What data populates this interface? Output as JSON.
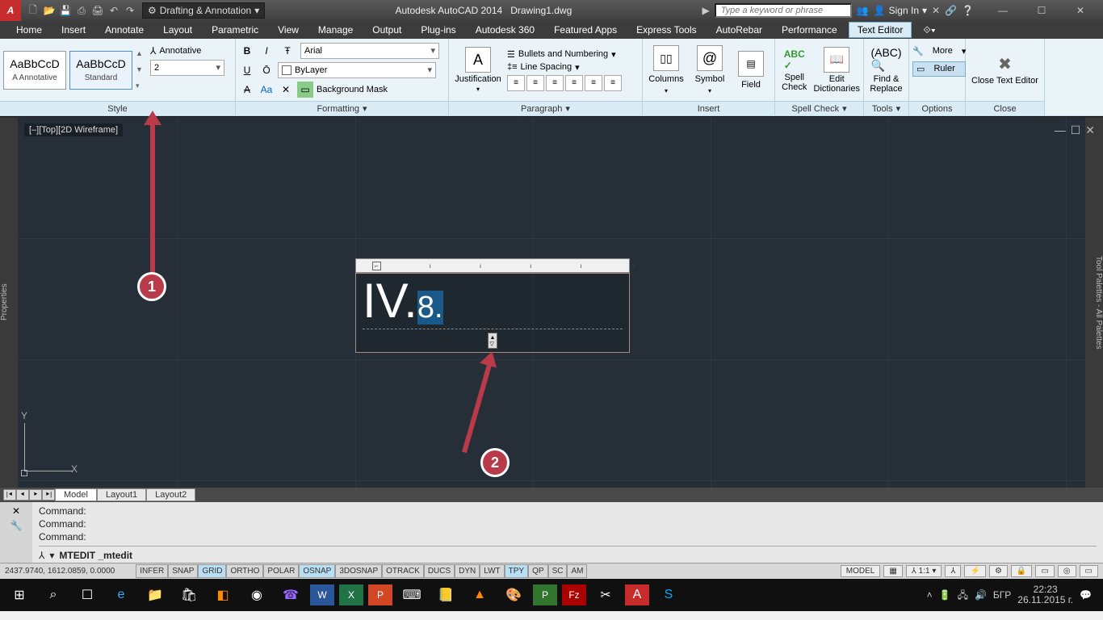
{
  "title": {
    "app": "Autodesk AutoCAD 2014",
    "file": "Drawing1.dwg"
  },
  "workspace": "Drafting & Annotation",
  "search_placeholder": "Type a keyword or phrase",
  "signin": "Sign In",
  "tabs": [
    "Home",
    "Insert",
    "Annotate",
    "Layout",
    "Parametric",
    "View",
    "Manage",
    "Output",
    "Plug-ins",
    "Autodesk 360",
    "Featured Apps",
    "Express Tools",
    "AutoRebar",
    "Performance",
    "Text Editor"
  ],
  "active_tab": "Text Editor",
  "style": {
    "swatches": [
      {
        "sample": "AaBbCcD",
        "label": "A Annotative"
      },
      {
        "sample": "AaBbCcD",
        "label": "Standard"
      }
    ],
    "annotative": "Annotative",
    "size": "2",
    "panel": "Style"
  },
  "formatting": {
    "font": "Arial",
    "layer": "ByLayer",
    "bgmask": "Background Mask",
    "panel": "Formatting"
  },
  "paragraph": {
    "justification": "Justification",
    "bullets": "Bullets and Numbering",
    "linespacing": "Line Spacing",
    "panel": "Paragraph"
  },
  "insert": {
    "columns": "Columns",
    "symbol": "Symbol",
    "field": "Field",
    "panel": "Insert"
  },
  "spellcheck": {
    "spell": "Spell\nCheck",
    "dict": "Edit\nDictionaries",
    "panel": "Spell Check"
  },
  "tools": {
    "find": "Find &\nReplace",
    "panel": "Tools"
  },
  "options": {
    "more": "More",
    "ruler": "Ruler",
    "panel": "Options"
  },
  "close": {
    "btn": "Close Text Editor",
    "panel": "Close"
  },
  "canvas": {
    "view_label": "[–][Top][2D Wireframe]",
    "text_large": "IV.",
    "text_small": "8.",
    "properties": "Properties",
    "toolpalettes": "Tool Palettes - All Palettes"
  },
  "markers": {
    "m1": "1",
    "m2": "2"
  },
  "layout_tabs": [
    "Model",
    "Layout1",
    "Layout2"
  ],
  "command": {
    "history": [
      "Command:",
      "Command:",
      "Command:"
    ],
    "current": "MTEDIT _mtedit"
  },
  "status": {
    "coords": "2437.9740, 1612.0859, 0.0000",
    "toggles": [
      "INFER",
      "SNAP",
      "GRID",
      "ORTHO",
      "POLAR",
      "OSNAP",
      "3DOSNAP",
      "OTRACK",
      "DUCS",
      "DYN",
      "LWT",
      "TPY",
      "QP",
      "SC",
      "AM"
    ],
    "toggles_on": [
      "GRID",
      "OSNAP",
      "TPY"
    ],
    "model": "MODEL",
    "scale": "1:1"
  },
  "taskbar": {
    "lang": "БГР",
    "time": "22:23",
    "date": "26.11.2015 г."
  }
}
